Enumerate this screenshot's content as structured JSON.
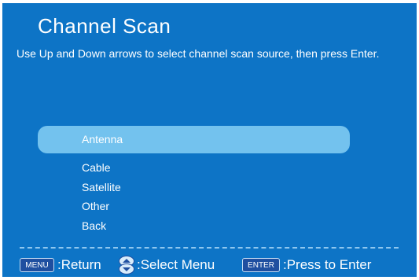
{
  "screen": {
    "title": "Channel Scan",
    "instructions": "Use Up and Down arrows to select channel scan source, then press Enter."
  },
  "menu": {
    "items": [
      {
        "label": "Antenna",
        "selected": true
      },
      {
        "label": "Cable",
        "selected": false
      },
      {
        "label": "Satellite",
        "selected": false
      },
      {
        "label": "Other",
        "selected": false
      },
      {
        "label": "Back",
        "selected": false
      }
    ]
  },
  "footer": {
    "menu_key": "MENU",
    "menu_action": ":Return",
    "updown_icon": "up-down-arrows-icon",
    "updown_action": ":Select Menu",
    "enter_key": "ENTER",
    "enter_action": ":Press to Enter"
  },
  "colors": {
    "background": "#0d74c6",
    "highlight": "#73c2ee",
    "key_bg": "#1f4fa0"
  }
}
